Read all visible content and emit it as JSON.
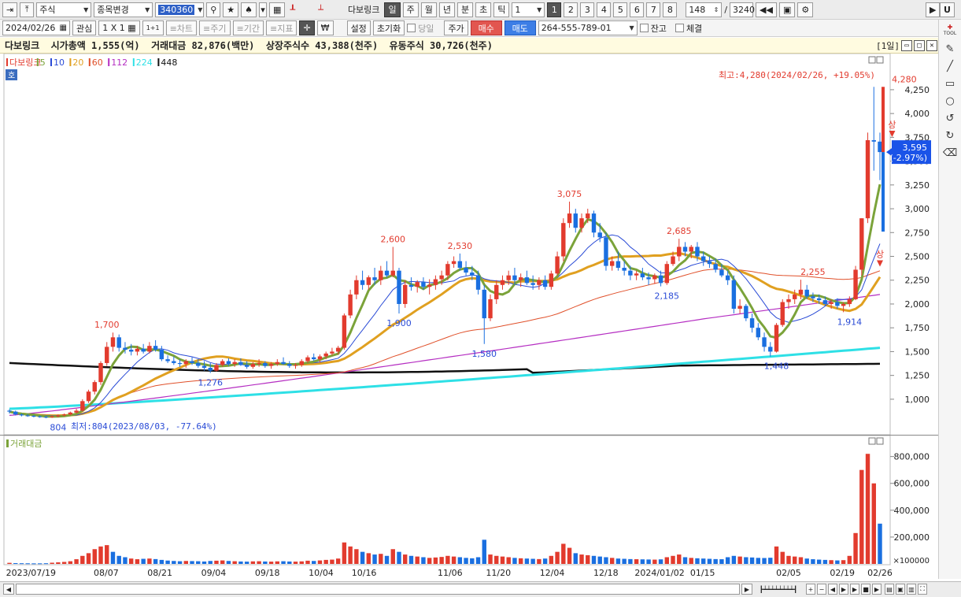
{
  "toolbar": {
    "market_select": "주식",
    "change_select": "종목변경",
    "code": "340360",
    "name": "다보링크",
    "periods": [
      "일",
      "주",
      "월",
      "년",
      "분",
      "초",
      "틱"
    ],
    "period_count": "1",
    "pages": [
      "1",
      "2",
      "3",
      "4",
      "5",
      "6",
      "7",
      "8"
    ],
    "view_count": "148",
    "slash": "/",
    "total_count": "3240",
    "u_label": "U"
  },
  "toolbar2": {
    "date": "2024/02/26",
    "interest": "관심",
    "layout": "1 X 1",
    "one_plus": "1+1",
    "chart_tab": "≡차트",
    "period_tab": "≡주기",
    "range_tab": "≡기간",
    "indicator_tab": "≡지표",
    "won_icon": "₩",
    "settings": "설정",
    "reset": "초기화",
    "today": "당일",
    "price": "주가",
    "buy": "매수",
    "sell": "매도",
    "account": "264-555-789-01",
    "balance": "잔고",
    "filled": "체결"
  },
  "info": {
    "name": "다보링크",
    "mcap_label": "시가총액",
    "mcap": "1,555(억)",
    "turnover_label": "거래대금",
    "turnover": "82,876(백만)",
    "listed_label": "상장주식수",
    "listed": "43,388(천주)",
    "float_label": "유동주식",
    "float": "30,726(천주)",
    "period_tag": "[1일]"
  },
  "chart_data": {
    "type": "candlestick",
    "legend": [
      {
        "label": "다보링크",
        "color": "#e23b2e"
      },
      {
        "label": "5",
        "color": "#7ba33a"
      },
      {
        "label": "10",
        "color": "#2a4bd6"
      },
      {
        "label": "20",
        "color": "#e0a020"
      },
      {
        "label": "60",
        "color": "#e0502a"
      },
      {
        "label": "112",
        "color": "#b52ec2"
      },
      {
        "label": "224",
        "color": "#2ee0e6"
      },
      {
        "label": "448",
        "color": "#111111"
      }
    ],
    "hoga_badge": "호",
    "y_ticks": [
      "4,250",
      "4,000",
      "3,750",
      "3,500",
      "3,250",
      "3,000",
      "2,750",
      "2,500",
      "2,250",
      "2,000",
      "1,750",
      "1,500",
      "1,250",
      "1,000"
    ],
    "y_tick_values": [
      4250,
      4000,
      3750,
      3500,
      3250,
      3000,
      2750,
      2500,
      2250,
      2000,
      1750,
      1500,
      1250,
      1000
    ],
    "y_range": [
      660,
      4580
    ],
    "max_label": "최고:4,280(2024/02/26, +19.05%)",
    "min_label": "최저:804(2023/08/03, -77.64%)",
    "current_price": "3,595",
    "current_change": "(-2.97%)",
    "current_value": 3595,
    "annotations": [
      {
        "text": "804",
        "value": 804,
        "pos": "below",
        "idx": 8
      },
      {
        "text": "1,700",
        "value": 1700,
        "pos": "above",
        "idx": 16
      },
      {
        "text": "1,276",
        "value": 1276,
        "pos": "below",
        "idx": 33
      },
      {
        "text": "2,600",
        "value": 2600,
        "pos": "above",
        "idx": 63
      },
      {
        "text": "1,900",
        "value": 1900,
        "pos": "below",
        "idx": 64
      },
      {
        "text": "2,530",
        "value": 2530,
        "pos": "above",
        "idx": 74
      },
      {
        "text": "1,580",
        "value": 1580,
        "pos": "below",
        "idx": 78
      },
      {
        "text": "3,075",
        "value": 3075,
        "pos": "above",
        "idx": 92
      },
      {
        "text": "2,185",
        "value": 2185,
        "pos": "below",
        "idx": 108
      },
      {
        "text": "2,685",
        "value": 2685,
        "pos": "above",
        "idx": 110
      },
      {
        "text": "1,448",
        "value": 1448,
        "pos": "below",
        "idx": 126
      },
      {
        "text": "2,255",
        "value": 2255,
        "pos": "above",
        "idx": 132
      },
      {
        "text": "1,914",
        "value": 1914,
        "pos": "below",
        "idx": 138
      },
      {
        "text": "4,280",
        "value": 4280,
        "pos": "above",
        "idx": 147
      }
    ],
    "limit_up_label": "상",
    "limit_up_markers": [
      {
        "idx": 143,
        "value": 2360
      },
      {
        "idx": 145,
        "value": 3720
      }
    ],
    "x_labels": [
      "2023/07/19",
      "08/07",
      "08/21",
      "09/04",
      "09/18",
      "10/04",
      "10/16",
      "11/06",
      "11/20",
      "12/04",
      "12/18",
      "2024/01/02",
      "01/15",
      "02/05",
      "02/19",
      "02/26"
    ],
    "x_label_idx": [
      4,
      18,
      28,
      38,
      48,
      58,
      66,
      82,
      91,
      101,
      111,
      121,
      129,
      145,
      155,
      162
    ],
    "volume_title": "거래대금",
    "volume_ticks": [
      "800,000",
      "600,000",
      "400,000",
      "200,000",
      "×100000"
    ],
    "volume_tick_values": [
      800000,
      600000,
      400000,
      200000
    ],
    "volume_range": [
      0,
      880000
    ],
    "candles": [
      [
        880,
        895,
        850,
        870
      ],
      [
        870,
        880,
        830,
        840
      ],
      [
        840,
        850,
        820,
        830
      ],
      [
        830,
        845,
        815,
        825
      ],
      [
        825,
        835,
        810,
        820
      ],
      [
        820,
        830,
        805,
        815
      ],
      [
        815,
        825,
        800,
        810
      ],
      [
        810,
        830,
        804,
        820
      ],
      [
        820,
        840,
        810,
        830
      ],
      [
        830,
        850,
        820,
        840
      ],
      [
        840,
        870,
        830,
        860
      ],
      [
        860,
        900,
        850,
        880
      ],
      [
        880,
        1000,
        870,
        980
      ],
      [
        980,
        1100,
        960,
        1080
      ],
      [
        1080,
        1200,
        1050,
        1180
      ],
      [
        1180,
        1400,
        1150,
        1380
      ],
      [
        1380,
        1600,
        1350,
        1550
      ],
      [
        1550,
        1700,
        1500,
        1650
      ],
      [
        1650,
        1680,
        1500,
        1540
      ],
      [
        1540,
        1600,
        1480,
        1520
      ],
      [
        1520,
        1580,
        1460,
        1500
      ],
      [
        1500,
        1560,
        1460,
        1530
      ],
      [
        1530,
        1580,
        1480,
        1500
      ],
      [
        1500,
        1600,
        1480,
        1560
      ],
      [
        1560,
        1620,
        1500,
        1520
      ],
      [
        1520,
        1560,
        1400,
        1420
      ],
      [
        1420,
        1460,
        1380,
        1400
      ],
      [
        1400,
        1450,
        1360,
        1380
      ],
      [
        1380,
        1420,
        1340,
        1370
      ],
      [
        1370,
        1420,
        1330,
        1400
      ],
      [
        1400,
        1440,
        1360,
        1380
      ],
      [
        1380,
        1420,
        1330,
        1350
      ],
      [
        1350,
        1400,
        1300,
        1330
      ],
      [
        1330,
        1380,
        1276,
        1300
      ],
      [
        1300,
        1380,
        1290,
        1360
      ],
      [
        1360,
        1420,
        1340,
        1400
      ],
      [
        1400,
        1430,
        1350,
        1370
      ],
      [
        1370,
        1420,
        1340,
        1390
      ],
      [
        1390,
        1430,
        1350,
        1360
      ],
      [
        1360,
        1400,
        1320,
        1340
      ],
      [
        1340,
        1390,
        1320,
        1370
      ],
      [
        1370,
        1420,
        1340,
        1380
      ],
      [
        1380,
        1400,
        1330,
        1350
      ],
      [
        1350,
        1390,
        1320,
        1370
      ],
      [
        1370,
        1420,
        1350,
        1390
      ],
      [
        1390,
        1440,
        1360,
        1370
      ],
      [
        1370,
        1400,
        1330,
        1350
      ],
      [
        1350,
        1380,
        1320,
        1360
      ],
      [
        1360,
        1420,
        1340,
        1400
      ],
      [
        1400,
        1460,
        1380,
        1440
      ],
      [
        1440,
        1480,
        1400,
        1420
      ],
      [
        1420,
        1470,
        1390,
        1450
      ],
      [
        1450,
        1500,
        1420,
        1480
      ],
      [
        1480,
        1540,
        1460,
        1500
      ],
      [
        1500,
        1560,
        1470,
        1540
      ],
      [
        1540,
        1900,
        1520,
        1880
      ],
      [
        1880,
        2150,
        1850,
        2100
      ],
      [
        2100,
        2300,
        2050,
        2250
      ],
      [
        2250,
        2350,
        2150,
        2200
      ],
      [
        2200,
        2300,
        2150,
        2280
      ],
      [
        2280,
        2380,
        2200,
        2250
      ],
      [
        2250,
        2400,
        2200,
        2350
      ],
      [
        2350,
        2450,
        2280,
        2300
      ],
      [
        2300,
        2600,
        2280,
        2350
      ],
      [
        2350,
        2380,
        1900,
        2000
      ],
      [
        2000,
        2250,
        1960,
        2200
      ],
      [
        2200,
        2280,
        2140,
        2180
      ],
      [
        2180,
        2250,
        2120,
        2230
      ],
      [
        2230,
        2280,
        2150,
        2180
      ],
      [
        2180,
        2260,
        2100,
        2200
      ],
      [
        2200,
        2300,
        2150,
        2260
      ],
      [
        2260,
        2350,
        2200,
        2300
      ],
      [
        2300,
        2450,
        2250,
        2420
      ],
      [
        2420,
        2500,
        2380,
        2450
      ],
      [
        2450,
        2530,
        2350,
        2380
      ],
      [
        2380,
        2450,
        2300,
        2330
      ],
      [
        2330,
        2400,
        2250,
        2300
      ],
      [
        2300,
        2350,
        2100,
        2150
      ],
      [
        2150,
        2200,
        1580,
        1850
      ],
      [
        1850,
        2100,
        1820,
        2050
      ],
      [
        2050,
        2250,
        2000,
        2200
      ],
      [
        2200,
        2300,
        2150,
        2250
      ],
      [
        2250,
        2350,
        2200,
        2300
      ],
      [
        2300,
        2380,
        2200,
        2250
      ],
      [
        2250,
        2320,
        2180,
        2280
      ],
      [
        2280,
        2350,
        2200,
        2220
      ],
      [
        2220,
        2300,
        2150,
        2200
      ],
      [
        2200,
        2280,
        2150,
        2250
      ],
      [
        2250,
        2300,
        2150,
        2180
      ],
      [
        2180,
        2350,
        2150,
        2320
      ],
      [
        2320,
        2550,
        2300,
        2500
      ],
      [
        2500,
        2900,
        2450,
        2850
      ],
      [
        2850,
        3075,
        2800,
        2950
      ],
      [
        2950,
        3000,
        2750,
        2800
      ],
      [
        2800,
        2950,
        2750,
        2900
      ],
      [
        2900,
        3000,
        2850,
        2950
      ],
      [
        2950,
        2980,
        2700,
        2750
      ],
      [
        2750,
        2850,
        2650,
        2700
      ],
      [
        2700,
        2750,
        2350,
        2400
      ],
      [
        2400,
        2500,
        2350,
        2450
      ],
      [
        2450,
        2550,
        2350,
        2380
      ],
      [
        2380,
        2450,
        2300,
        2350
      ],
      [
        2350,
        2400,
        2250,
        2300
      ],
      [
        2300,
        2350,
        2250,
        2320
      ],
      [
        2320,
        2380,
        2250,
        2280
      ],
      [
        2280,
        2330,
        2200,
        2260
      ],
      [
        2260,
        2320,
        2210,
        2300
      ],
      [
        2300,
        2350,
        2185,
        2220
      ],
      [
        2220,
        2450,
        2200,
        2420
      ],
      [
        2420,
        2550,
        2400,
        2500
      ],
      [
        2500,
        2685,
        2450,
        2600
      ],
      [
        2600,
        2650,
        2500,
        2550
      ],
      [
        2550,
        2620,
        2480,
        2600
      ],
      [
        2600,
        2650,
        2450,
        2500
      ],
      [
        2500,
        2550,
        2400,
        2450
      ],
      [
        2450,
        2500,
        2380,
        2420
      ],
      [
        2420,
        2480,
        2330,
        2360
      ],
      [
        2360,
        2420,
        2280,
        2300
      ],
      [
        2300,
        2350,
        2200,
        2250
      ],
      [
        2250,
        2300,
        1900,
        1950
      ],
      [
        1950,
        2050,
        1900,
        1980
      ],
      [
        1980,
        2000,
        1820,
        1850
      ],
      [
        1850,
        1900,
        1700,
        1750
      ],
      [
        1750,
        1800,
        1620,
        1650
      ],
      [
        1650,
        1700,
        1500,
        1550
      ],
      [
        1550,
        1600,
        1448,
        1500
      ],
      [
        1500,
        1800,
        1490,
        1780
      ],
      [
        1780,
        2050,
        1760,
        2020
      ],
      [
        2020,
        2100,
        1950,
        2050
      ],
      [
        2050,
        2150,
        2000,
        2100
      ],
      [
        2100,
        2255,
        2050,
        2150
      ],
      [
        2150,
        2200,
        2050,
        2080
      ],
      [
        2080,
        2120,
        2020,
        2060
      ],
      [
        2060,
        2100,
        2000,
        2040
      ],
      [
        2040,
        2080,
        1980,
        2000
      ],
      [
        2000,
        2050,
        1950,
        2020
      ],
      [
        2020,
        2060,
        1950,
        1980
      ],
      [
        1980,
        2020,
        1914,
        2000
      ],
      [
        2000,
        2080,
        1970,
        2050
      ],
      [
        2050,
        2400,
        2040,
        2360
      ],
      [
        2360,
        2900,
        2300,
        2900
      ],
      [
        2900,
        3800,
        2850,
        3720
      ],
      [
        3720,
        4280,
        3400,
        3705
      ],
      [
        3705,
        3800,
        3300,
        3595
      ]
    ],
    "volume": [
      8000,
      6000,
      5000,
      4500,
      4000,
      4200,
      5000,
      9000,
      12000,
      15000,
      20000,
      35000,
      60000,
      80000,
      110000,
      130000,
      140000,
      90000,
      60000,
      50000,
      40000,
      35000,
      38000,
      40000,
      36000,
      30000,
      25000,
      22000,
      20000,
      22000,
      21000,
      20000,
      18000,
      22000,
      24000,
      26000,
      22000,
      20000,
      18000,
      17000,
      19000,
      20000,
      18000,
      17000,
      19000,
      20000,
      18000,
      17000,
      19000,
      24000,
      22000,
      26000,
      30000,
      32000,
      40000,
      160000,
      130000,
      110000,
      90000,
      80000,
      70000,
      75000,
      60000,
      110000,
      90000,
      70000,
      60000,
      55000,
      50000,
      45000,
      48000,
      52000,
      60000,
      55000,
      50000,
      45000,
      42000,
      50000,
      180000,
      70000,
      60000,
      55000,
      50000,
      45000,
      42000,
      40000,
      38000,
      36000,
      40000,
      60000,
      90000,
      150000,
      120000,
      80000,
      70000,
      65000,
      60000,
      55000,
      50000,
      45000,
      40000,
      38000,
      36000,
      35000,
      34000,
      33000,
      32000,
      34000,
      50000,
      60000,
      70000,
      50000,
      45000,
      42000,
      40000,
      38000,
      36000,
      35000,
      50000,
      60000,
      55000,
      50000,
      48000,
      45000,
      44000,
      46000,
      130000,
      90000,
      60000,
      55000,
      50000,
      40000,
      35000,
      32000,
      30000,
      28000,
      26000,
      28000,
      60000,
      230000,
      700000,
      820000,
      600000,
      300000
    ],
    "volume_up": [
      true,
      false,
      false,
      false,
      false,
      false,
      false,
      true,
      true,
      true,
      true,
      true,
      true,
      true,
      true,
      true,
      true,
      false,
      false,
      false,
      true,
      true,
      false,
      true,
      false,
      false,
      false,
      false,
      false,
      true,
      false,
      false,
      false,
      false,
      true,
      true,
      false,
      true,
      false,
      false,
      true,
      true,
      false,
      true,
      true,
      false,
      false,
      true,
      true,
      true,
      false,
      true,
      true,
      true,
      true,
      true,
      true,
      true,
      false,
      true,
      false,
      true,
      false,
      true,
      false,
      true,
      false,
      true,
      false,
      true,
      true,
      true,
      true,
      true,
      false,
      false,
      false,
      false,
      false,
      true,
      true,
      true,
      true,
      false,
      true,
      false,
      false,
      true,
      false,
      true,
      true,
      true,
      true,
      false,
      true,
      true,
      false,
      false,
      false,
      true,
      false,
      false,
      false,
      true,
      false,
      false,
      true,
      false,
      true,
      true,
      true,
      false,
      true,
      false,
      false,
      false,
      false,
      false,
      false,
      false,
      true,
      false,
      false,
      false,
      false,
      false,
      true,
      true,
      true,
      true,
      true,
      false,
      false,
      false,
      false,
      true,
      false,
      true,
      true,
      true,
      true,
      true,
      true,
      false
    ]
  }
}
